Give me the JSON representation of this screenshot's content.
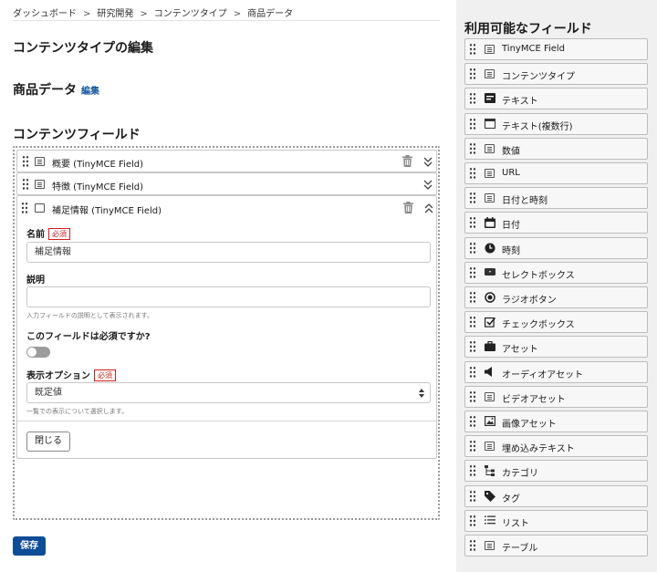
{
  "breadcrumb": [
    "ダッシュボード",
    "研究開発",
    "コンテンツタイプ",
    "商品データ"
  ],
  "breadcrumb_separator": ">",
  "page_title": "コンテンツタイプの編集",
  "content_type": {
    "name": "商品データ",
    "edit_link": "編集"
  },
  "fields_section_title": "コンテンツフィールド",
  "fields": [
    {
      "label": "概要 (TinyMCE Field)",
      "expanded": false
    },
    {
      "label": "特徴 (TinyMCE Field)",
      "expanded": false
    },
    {
      "label": "補足情報 (TinyMCE Field)",
      "expanded": true
    }
  ],
  "chevron_down": "⌄",
  "chevron_up": "⌃",
  "field_form": {
    "name_label": "名前",
    "required_badge": "必須",
    "name_value": "補足情報",
    "description_label": "説明",
    "description_value": "",
    "description_hint": "入力フィールドの説明として表示されます。",
    "required_question": "このフィールドは必須ですか?",
    "required_toggle_on": false,
    "display_option_label": "表示オプション",
    "display_option_value": "既定値",
    "display_option_hint": "一覧での表示について選択します。",
    "close_button": "閉じる"
  },
  "save_button": "保存",
  "sidebar": {
    "title": "利用可能なフィールド",
    "items": [
      {
        "label": "TinyMCE Field",
        "icon": "box-lines"
      },
      {
        "label": "コンテンツタイプ",
        "icon": "box-lines"
      },
      {
        "label": "テキスト",
        "icon": "text-field-dark"
      },
      {
        "label": "テキスト(複数行)",
        "icon": "window"
      },
      {
        "label": "数値",
        "icon": "box-lines"
      },
      {
        "label": "URL",
        "icon": "box-lines"
      },
      {
        "label": "日付と時刻",
        "icon": "box-lines"
      },
      {
        "label": "日付",
        "icon": "calendar"
      },
      {
        "label": "時刻",
        "icon": "clock"
      },
      {
        "label": "セレクトボックス",
        "icon": "select"
      },
      {
        "label": "ラジオボタン",
        "icon": "radio"
      },
      {
        "label": "チェックボックス",
        "icon": "checkbox"
      },
      {
        "label": "アセット",
        "icon": "briefcase"
      },
      {
        "label": "オーディオアセット",
        "icon": "speaker"
      },
      {
        "label": "ビデオアセット",
        "icon": "box-lines"
      },
      {
        "label": "画像アセット",
        "icon": "image"
      },
      {
        "label": "埋め込みテキスト",
        "icon": "box-lines"
      },
      {
        "label": "カテゴリ",
        "icon": "tree"
      },
      {
        "label": "タグ",
        "icon": "tag"
      },
      {
        "label": "リスト",
        "icon": "list"
      },
      {
        "label": "テーブル",
        "icon": "box-lines"
      }
    ]
  }
}
